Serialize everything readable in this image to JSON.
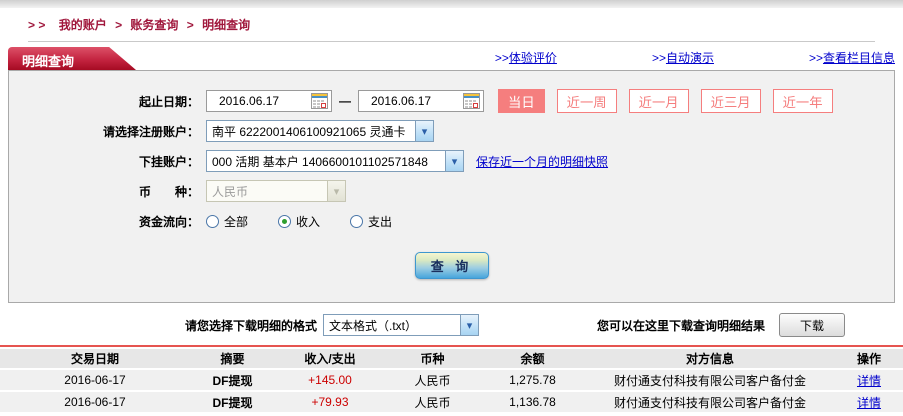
{
  "breadcrumb": {
    "prefix": "> >",
    "separator": ">",
    "items": [
      "我的账户",
      "账务查询",
      "明细查询"
    ]
  },
  "tab": {
    "title": "明细查询"
  },
  "links": {
    "prefix": ">>",
    "items": [
      {
        "label": "体验评价"
      },
      {
        "label": "自动演示"
      },
      {
        "label": "查看栏目信息"
      }
    ]
  },
  "icons": {
    "chevron_down": "▾"
  },
  "form": {
    "date_label": "起止日期：",
    "date_from": "2016.06.17",
    "date_to": "2016.06.17",
    "date_separator": "—",
    "quick_buttons": [
      {
        "label": "当日",
        "active": true
      },
      {
        "label": "近一周",
        "active": false
      },
      {
        "label": "近一月",
        "active": false
      },
      {
        "label": "近三月",
        "active": false
      },
      {
        "label": "近一年",
        "active": false
      }
    ],
    "account_label": "请选择注册账户：",
    "account_value": "南平  6222001406100921065  灵通卡",
    "sub_account_label": "下挂账户：",
    "sub_account_value": "000 活期 基本户 1406600101102571848",
    "snapshot_link": "保存近一个月的明细快照",
    "currency_label": "币　　种：",
    "currency_value": "人民币",
    "flow_label": "资金流向：",
    "flow_options": [
      {
        "label": "全部",
        "checked": false
      },
      {
        "label": "收入",
        "checked": true
      },
      {
        "label": "支出",
        "checked": false
      }
    ],
    "query_button": "查 询"
  },
  "download": {
    "format_label": "请您选择下载明细的格式",
    "format_value": "文本格式（.txt）",
    "hint": "您可以在这里下载查询明细结果",
    "button": "下载"
  },
  "table": {
    "headers": [
      "交易日期",
      "摘要",
      "收入/支出",
      "币种",
      "余额",
      "对方信息",
      "操作"
    ],
    "rows": [
      {
        "date": "2016-06-17",
        "summary": "DF提现",
        "amount": "+145.00",
        "currency": "人民币",
        "balance": "1,275.78",
        "counterparty": "财付通支付科技有限公司客户备付金",
        "action": "详情"
      },
      {
        "date": "2016-06-17",
        "summary": "DF提现",
        "amount": "+79.93",
        "currency": "人民币",
        "balance": "1,136.78",
        "counterparty": "财付通支付科技有限公司客户备付金",
        "action": "详情"
      }
    ]
  },
  "colors": {
    "accent_maroon": "#a0173c",
    "tab_red": "#a50b23",
    "salmon": "#f57e7e",
    "link_blue": "#0000cc",
    "amount_red": "#cc0000",
    "table_line_red": "#e65450"
  }
}
